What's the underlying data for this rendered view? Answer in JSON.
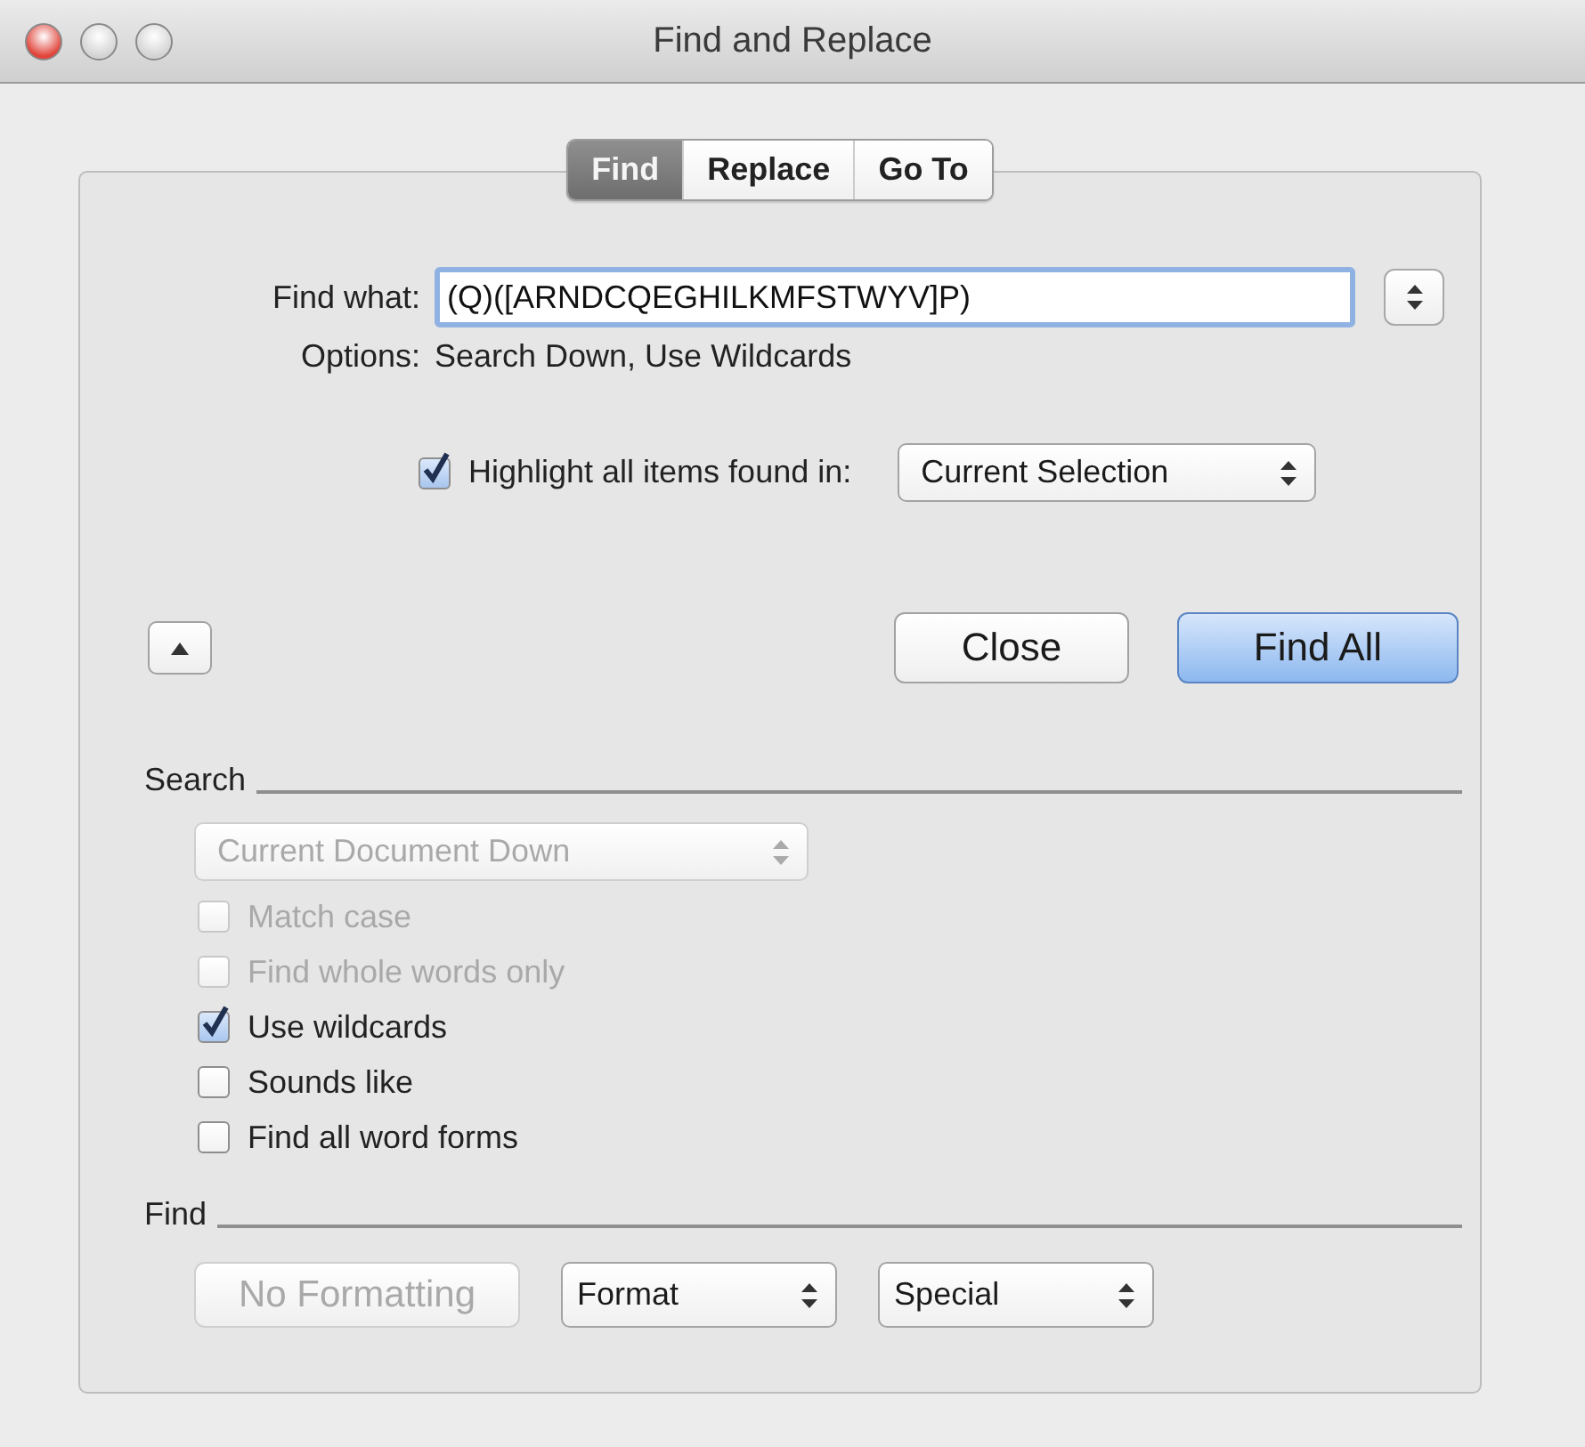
{
  "window": {
    "title": "Find and Replace"
  },
  "tabs": [
    {
      "label": "Find",
      "selected": true
    },
    {
      "label": "Replace",
      "selected": false
    },
    {
      "label": "Go To",
      "selected": false
    }
  ],
  "find_what": {
    "label": "Find what:",
    "value": "(Q)([ARNDCQEGHILKMFSTWYV]P)"
  },
  "options": {
    "label": "Options:",
    "text": "Search Down, Use Wildcards"
  },
  "highlight": {
    "label": "Highlight all items found in:",
    "checked": true,
    "dropdown": "Current Selection"
  },
  "buttons": [
    {
      "label": "Close",
      "default": false
    },
    {
      "label": "Find All",
      "default": true
    }
  ],
  "search_section": {
    "title": "Search",
    "dropdown": {
      "value": "Current Document Down",
      "disabled": true
    },
    "checkboxes": [
      {
        "label": "Match case",
        "checked": false,
        "disabled": true
      },
      {
        "label": "Find whole words only",
        "checked": false,
        "disabled": true
      },
      {
        "label": "Use wildcards",
        "checked": true,
        "disabled": false
      },
      {
        "label": "Sounds like",
        "checked": false,
        "disabled": false
      },
      {
        "label": "Find all word forms",
        "checked": false,
        "disabled": false
      }
    ]
  },
  "find_section": {
    "title": "Find",
    "controls": [
      {
        "kind": "button",
        "label": "No Formatting",
        "disabled": true
      },
      {
        "kind": "popup",
        "label": "Format",
        "disabled": false
      },
      {
        "kind": "popup",
        "label": "Special",
        "disabled": false
      }
    ]
  }
}
